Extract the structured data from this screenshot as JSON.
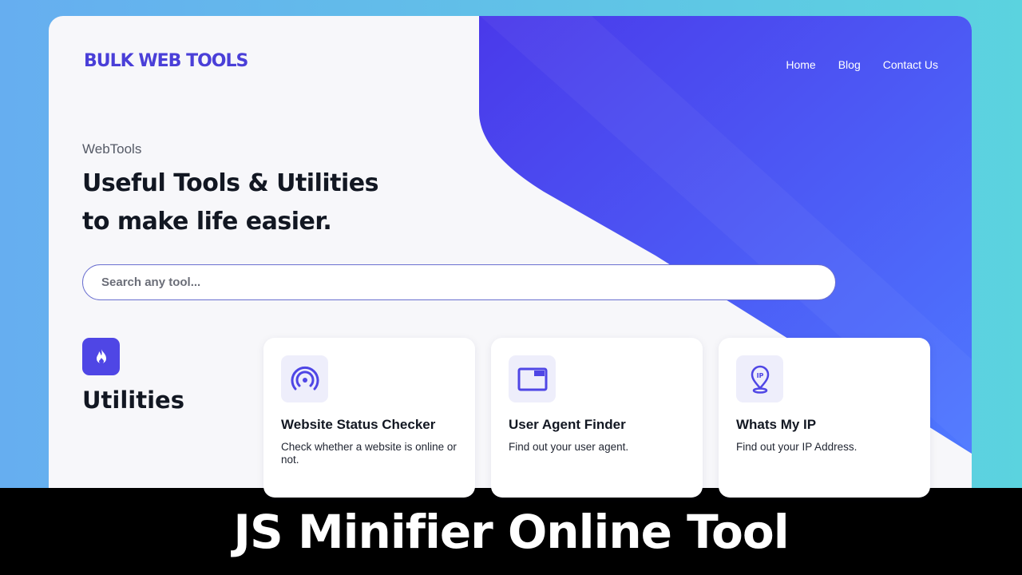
{
  "brand": {
    "name": "BULK WEB TOOLS",
    "color": "#4a3fd8"
  },
  "nav": {
    "items": [
      {
        "label": "Home"
      },
      {
        "label": "Blog"
      },
      {
        "label": "Contact Us"
      }
    ]
  },
  "hero": {
    "eyebrow": "WebTools",
    "headline_line1": "Useful Tools & Utilities",
    "headline_line2": "to make life easier."
  },
  "search": {
    "placeholder": "Search any tool..."
  },
  "category": {
    "title": "Utilities",
    "icon": "flame-icon"
  },
  "tools": [
    {
      "title": "Website Status Checker",
      "description": "Check whether a website is online or not.",
      "icon": "broadcast-icon"
    },
    {
      "title": "User Agent Finder",
      "description": "Find out your user agent.",
      "icon": "browser-window-icon"
    },
    {
      "title": "Whats My IP",
      "description": "Find out your IP Address.",
      "icon": "ip-location-pin-icon"
    }
  ],
  "caption": "JS Minifier Online Tool",
  "colors": {
    "accent": "#4f46e5",
    "hero_gradient_start": "#4a3bea",
    "hero_gradient_end": "#4d75ff"
  }
}
